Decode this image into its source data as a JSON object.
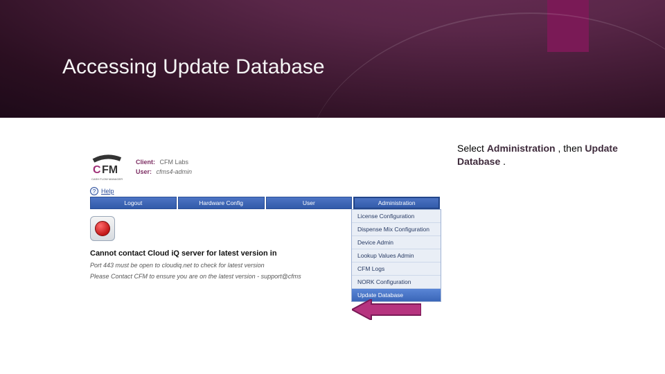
{
  "slide": {
    "title": "Accessing Update Database"
  },
  "instruction": {
    "prefix": "Select ",
    "kw1": "Administration",
    "mid": ", then ",
    "kw2": "Update Database",
    "suffix": "."
  },
  "app": {
    "logo_text": "CFM",
    "logo_sub": "CASH FLOW MANAGER",
    "client_label": "Client:",
    "client_value": "CFM Labs",
    "user_label": "User:",
    "user_value": "cfms4-admin",
    "help": "Help",
    "nav": {
      "logout": "Logout",
      "hardware": "Hardware Config",
      "user": "User",
      "admin": "Administration"
    },
    "dropdown": {
      "items": [
        "License Configuration",
        "Dispense Mix Configuration",
        "Device Admin",
        "Lookup Values Admin",
        "CFM Logs",
        "NORK Configuration",
        "Update Database"
      ]
    },
    "error": {
      "title": "Cannot contact Cloud iQ server for latest version in",
      "line1": "Port 443 must be open to cloudiq.net to check for latest version",
      "line2": "Please Contact CFM to ensure you are on the latest version - support@cfms"
    }
  }
}
